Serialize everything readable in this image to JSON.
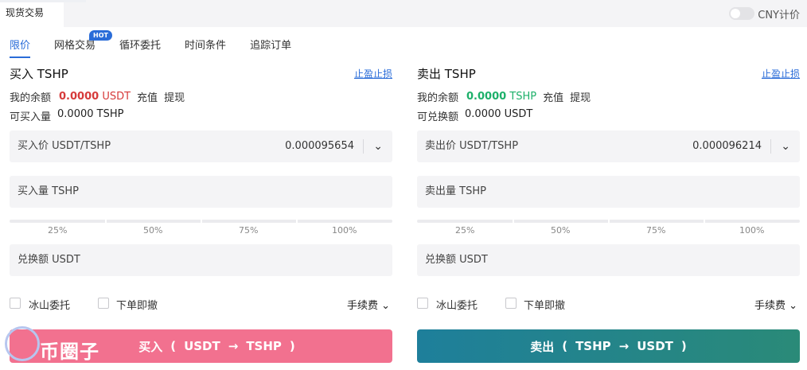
{
  "header": {
    "tab": "现货交易",
    "cny_label": "CNY计价"
  },
  "order_tabs": [
    {
      "label": "限价"
    },
    {
      "label": "网格交易",
      "badge": "HOT"
    },
    {
      "label": "循环委托"
    },
    {
      "label": "时间条件"
    },
    {
      "label": "追踪订单"
    }
  ],
  "buy": {
    "title": "买入 TSHP",
    "stop_link": "止盈止损",
    "balance_label": "我的余额",
    "balance_amount": "0.0000",
    "balance_unit": "USDT",
    "deposit": "充值",
    "withdraw": "提现",
    "avail_label": "可买入量",
    "avail_value": "0.0000 TSHP",
    "price_label": "买入价 USDT/TSHP",
    "price_value": "0.000095654",
    "amount_label": "买入量 TSHP",
    "total_label": "兑换额 USDT",
    "percents": [
      "25%",
      "50%",
      "75%",
      "100%"
    ],
    "iceberg": "冰山委托",
    "ioc": "下单即撤",
    "fee": "手续费",
    "button": {
      "action": "买入",
      "from": "USDT",
      "to": "TSHP"
    }
  },
  "sell": {
    "title": "卖出 TSHP",
    "stop_link": "止盈止损",
    "balance_label": "我的余额",
    "balance_amount": "0.0000",
    "balance_unit": "TSHP",
    "deposit": "充值",
    "withdraw": "提现",
    "avail_label": "可兑换额",
    "avail_value": "0.0000 USDT",
    "price_label": "卖出价 USDT/TSHP",
    "price_value": "0.000096214",
    "amount_label": "卖出量 TSHP",
    "total_label": "兑换额 USDT",
    "percents": [
      "25%",
      "50%",
      "75%",
      "100%"
    ],
    "iceberg": "冰山委托",
    "ioc": "下单即撤",
    "fee": "手续费",
    "button": {
      "action": "卖出",
      "from": "TSHP",
      "to": "USDT"
    }
  },
  "watermark": "币圈子",
  "colors": {
    "accent": "#2a6cd8",
    "buy": "#f2718f",
    "sell": "#1e7f9b",
    "balance_red": "#d63a3a",
    "balance_green": "#1db06a"
  }
}
